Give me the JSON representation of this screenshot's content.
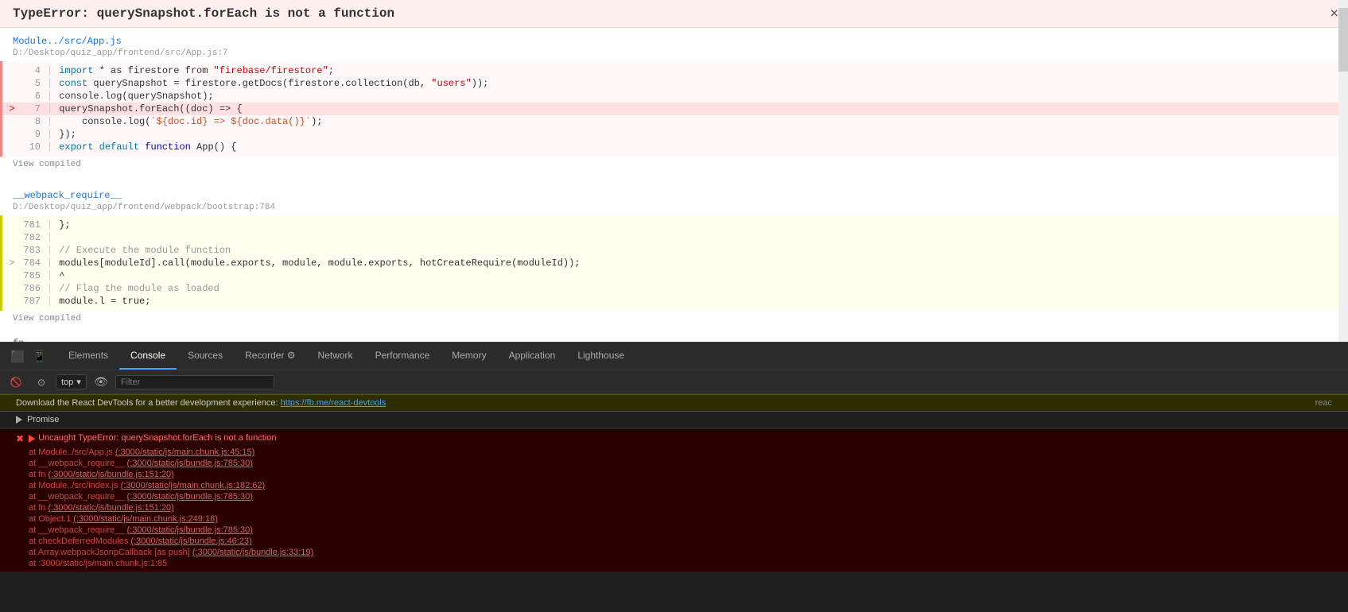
{
  "error_title": "TypeError: querySnapshot.forEach is not a function",
  "close_btn_label": "×",
  "code_section1": {
    "file_link": "Module../src/App.js",
    "file_path": "D:/Desktop/quiz_app/frontend/src/App.js:7",
    "lines": [
      {
        "num": "4",
        "arrow": "",
        "code_parts": [
          {
            "type": "kw2",
            "text": "import"
          },
          {
            "type": "plain",
            "text": " * as firestore from "
          },
          {
            "type": "str",
            "text": "\"firebase/firestore\""
          },
          {
            "type": "plain",
            "text": ";"
          }
        ]
      },
      {
        "num": "5",
        "arrow": "",
        "code_parts": [
          {
            "type": "kw2",
            "text": "const"
          },
          {
            "type": "plain",
            "text": " querySnapshot = firestore.getDocs(firestore.collection(db, "
          },
          {
            "type": "str",
            "text": "\"users\""
          },
          {
            "type": "plain",
            "text": "));"
          }
        ]
      },
      {
        "num": "6",
        "arrow": "",
        "code_parts": [
          {
            "type": "plain",
            "text": "console.log(querySnapshot);"
          }
        ]
      },
      {
        "num": "7",
        "arrow": ">",
        "code_parts": [
          {
            "type": "plain",
            "text": "querySnapshot.forEach((doc) => {",
            "highlight": true
          }
        ]
      },
      {
        "num": "8",
        "arrow": "",
        "code_parts": [
          {
            "type": "plain",
            "text": "    console.log("
          },
          {
            "type": "tpl",
            "text": "`${doc.id} => ${doc.data()}`"
          },
          {
            "type": "plain",
            "text": ");"
          }
        ]
      },
      {
        "num": "9",
        "arrow": "",
        "code_parts": [
          {
            "type": "plain",
            "text": "});"
          }
        ]
      },
      {
        "num": "10",
        "arrow": "",
        "code_parts": [
          {
            "type": "kw2",
            "text": "export"
          },
          {
            "type": "plain",
            "text": " "
          },
          {
            "type": "kw2",
            "text": "default"
          },
          {
            "type": "plain",
            "text": " "
          },
          {
            "type": "kw",
            "text": "function"
          },
          {
            "type": "plain",
            "text": " App() {"
          }
        ]
      }
    ],
    "view_compiled": "View compiled"
  },
  "code_section2": {
    "file_link": "__webpack_require__",
    "file_path": "D:/Desktop/quiz_app/frontend/webpack/bootstrap:784",
    "lines": [
      {
        "num": "781",
        "arrow": "",
        "code_parts": [
          {
            "type": "plain",
            "text": "};"
          }
        ]
      },
      {
        "num": "782",
        "arrow": "",
        "code_parts": [
          {
            "type": "plain",
            "text": ""
          }
        ]
      },
      {
        "num": "783",
        "arrow": "",
        "code_parts": [
          {
            "type": "comment",
            "text": "// Execute the module function"
          }
        ]
      },
      {
        "num": "784",
        "arrow": ">",
        "code_parts": [
          {
            "type": "plain",
            "text": "modules[moduleId].call(module.exports, module, module.exports, hotCreateRequire(moduleId));"
          }
        ]
      },
      {
        "num": "785",
        "arrow": "",
        "code_parts": [
          {
            "type": "plain",
            "text": "^"
          }
        ]
      },
      {
        "num": "786",
        "arrow": "",
        "code_parts": [
          {
            "type": "comment",
            "text": "// Flag the module as loaded"
          }
        ]
      },
      {
        "num": "787",
        "arrow": "",
        "code_parts": [
          {
            "type": "plain",
            "text": "module.l = true;"
          }
        ]
      }
    ],
    "view_compiled": "View compiled"
  },
  "fn_label": "fn",
  "devtools": {
    "tabs": [
      {
        "id": "elements",
        "label": "Elements",
        "active": false
      },
      {
        "id": "console",
        "label": "Console",
        "active": true
      },
      {
        "id": "sources",
        "label": "Sources",
        "active": false
      },
      {
        "id": "recorder",
        "label": "Recorder ⚙",
        "active": false
      },
      {
        "id": "network",
        "label": "Network",
        "active": false
      },
      {
        "id": "performance",
        "label": "Performance",
        "active": false
      },
      {
        "id": "memory",
        "label": "Memory",
        "active": false
      },
      {
        "id": "application",
        "label": "Application",
        "active": false
      },
      {
        "id": "lighthouse",
        "label": "Lighthouse",
        "active": false
      }
    ]
  },
  "console_filter": {
    "context_label": "top",
    "context_arrow": "▾",
    "filter_placeholder": "Filter"
  },
  "console_messages": {
    "devtools_banner": "Download the React DevTools for a better development experience:",
    "devtools_link_text": "https://fb.me/react-devtools",
    "devtools_suffix": "reac",
    "promise_label": "▶ Promise",
    "error": {
      "main": "▶ Uncaught TypeError: querySnapshot.forEach is not a function",
      "stack": [
        {
          "text": "at Module../src/App.js",
          "link": "(:3000/static/js/main.chunk.js:45:15)"
        },
        {
          "text": "at __webpack_require__",
          "link": "(:3000/static/js/bundle.js:785:30)"
        },
        {
          "text": "at fn",
          "link": "(:3000/static/js/bundle.js:151:20)"
        },
        {
          "text": "at Module../src/index.js",
          "link": "(:3000/static/js/main.chunk.js:182:62)"
        },
        {
          "text": "at __webpack_require__",
          "link": "(:3000/static/js/bundle.js:785:30)"
        },
        {
          "text": "at fn",
          "link": "(:3000/static/js/bundle.js:151:20)"
        },
        {
          "text": "at Object.1",
          "link": "(:3000/static/js/main.chunk.js:249:18)"
        },
        {
          "text": "at __webpack_require__",
          "link": "(:3000/static/js/bundle.js:785:30)"
        },
        {
          "text": "at checkDeferredModules",
          "link": "(:3000/static/js/bundle.js:46:23)"
        },
        {
          "text": "at Array.webpackJsonpCallback [as push]",
          "link": "(:3000/static/js/bundle.js:33:19)"
        },
        {
          "text": "at :3000/static/js/main.chunk.js:1:85",
          "link": ""
        }
      ]
    }
  }
}
